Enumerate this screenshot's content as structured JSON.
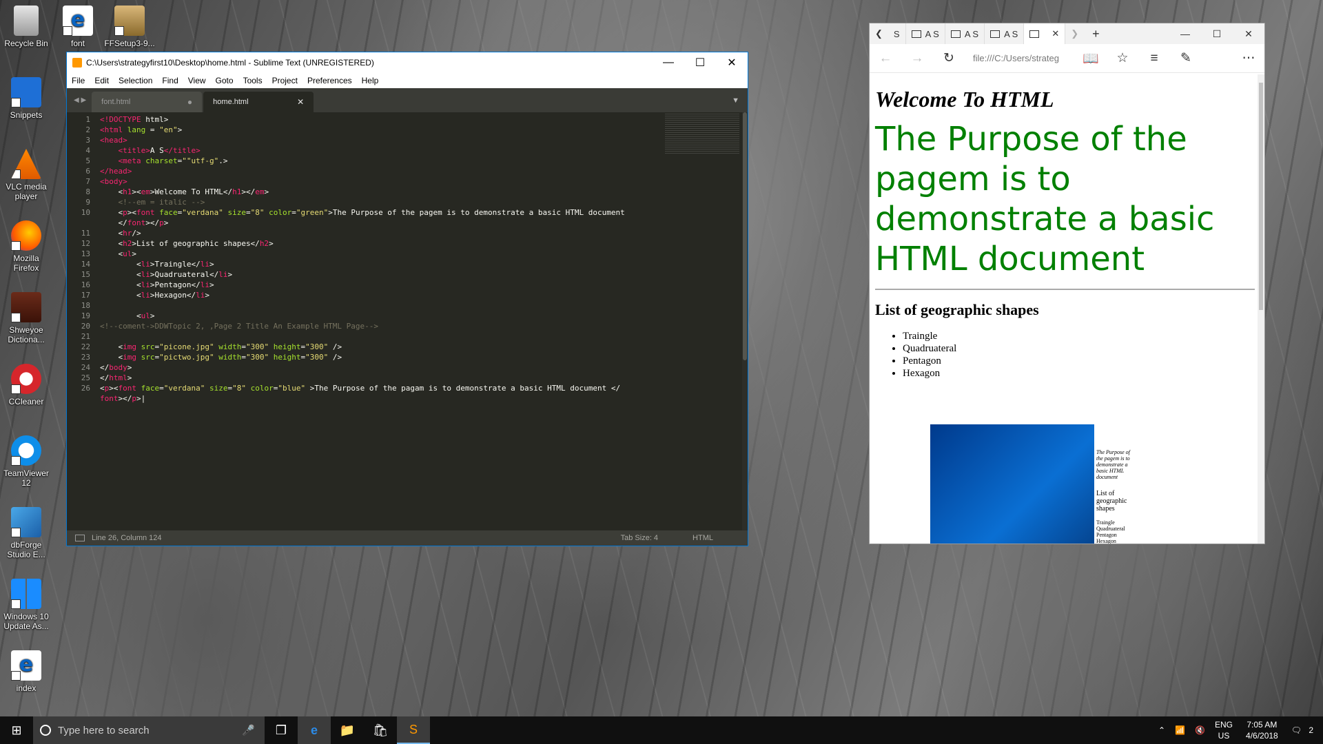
{
  "desktop": {
    "icons": [
      {
        "label": "Recycle Bin"
      },
      {
        "label": "font"
      },
      {
        "label": "FFSetup3-9..."
      },
      {
        "label": "Snippets"
      },
      {
        "label": "VLC media player"
      },
      {
        "label": "Mozilla Firefox"
      },
      {
        "label": "Shweyoe Dictiona..."
      },
      {
        "label": "CCleaner"
      },
      {
        "label": "TeamViewer 12"
      },
      {
        "label": "dbForge Studio E..."
      },
      {
        "label": "Windows 10 Update As..."
      },
      {
        "label": "index"
      }
    ]
  },
  "sublime": {
    "title": "C:\\Users\\strategyfirst10\\Desktop\\home.html - Sublime Text (UNREGISTERED)",
    "menu": [
      "File",
      "Edit",
      "Selection",
      "Find",
      "View",
      "Goto",
      "Tools",
      "Project",
      "Preferences",
      "Help"
    ],
    "tabs": [
      {
        "label": "font.html",
        "marker": "●"
      },
      {
        "label": "home.html",
        "marker": "✕"
      }
    ],
    "line_numbers": [
      "1",
      "2",
      "3",
      "4",
      "5",
      "6",
      "7",
      "8",
      "9",
      "10",
      "",
      "11",
      "12",
      "13",
      "14",
      "15",
      "16",
      "17",
      "18",
      "19",
      "20",
      "21",
      "22",
      "23",
      "24",
      "25",
      "26"
    ],
    "status": {
      "position": "Line 26, Column 124",
      "tab_size": "Tab Size: 4",
      "syntax": "HTML"
    }
  },
  "edge": {
    "tabs": [
      {
        "label": "S"
      },
      {
        "label": "A S"
      },
      {
        "label": "A S"
      },
      {
        "label": "A S"
      }
    ],
    "address": "file:///C:/Users/strateg",
    "page": {
      "h1": "Welcome To HTML",
      "green_text": "The Purpose of the pagem is to demonstrate a basic HTML document",
      "h2": "List of geographic shapes",
      "list": [
        "Traingle",
        "Quadruateral",
        "Pentagon",
        "Hexagon"
      ],
      "thumb_text": "The Purpose of the pagem is to demonstrate a basic HTML document",
      "thumb_h2": "List of geographic shapes",
      "thumb_list": [
        "Traingle",
        "Quadruateral",
        "Pentagon",
        "Hexagon"
      ]
    }
  },
  "taskbar": {
    "search_placeholder": "Type here to search",
    "language": "ENG",
    "region": "US",
    "time": "7:05 AM",
    "date": "4/6/2018",
    "notifications": "2"
  }
}
